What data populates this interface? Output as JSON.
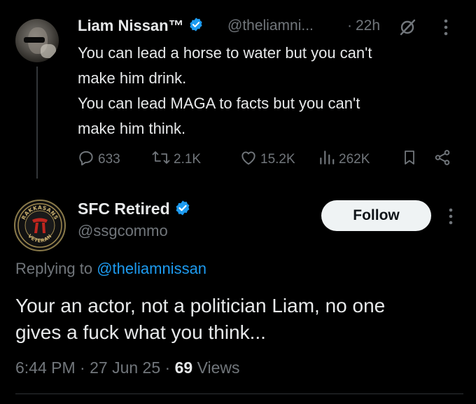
{
  "parent_tweet": {
    "author_name": "Liam Nissan™",
    "handle": "@theliamni...",
    "separator": "·",
    "time": "22h",
    "text_lines": [
      "You can lead a horse to water but you can't",
      "make him drink.",
      "You can lead MAGA to facts but you can't",
      "make him think."
    ],
    "stats": {
      "replies": "633",
      "reposts": "2.1K",
      "likes": "15.2K",
      "views": "262K"
    }
  },
  "reply_tweet": {
    "author_name": "SFC Retired",
    "handle": "@ssgcommo",
    "follow_label": "Follow",
    "replying_prefix": "Replying to ",
    "replying_to": "@theliamnissan",
    "text_lines": [
      "Your an actor, not a politician Liam, no one",
      "gives a fuck what you think..."
    ],
    "time": "6:44 PM",
    "separator": "·",
    "date": "27 Jun 25",
    "views_count": "69",
    "views_label": "Views",
    "avatar_text_top": "RAKKASANS",
    "avatar_text_bottom": "VETERAN"
  },
  "colors": {
    "background": "#000000",
    "text": "#e7e9ea",
    "muted": "#71767b",
    "link": "#1d9bf0",
    "verified": "#1d9bf0",
    "follow_bg": "#eff3f4"
  },
  "icons": [
    "verified-badge-icon",
    "grok-icon",
    "more-icon",
    "reply-icon",
    "repost-icon",
    "like-icon",
    "views-icon",
    "bookmark-icon",
    "share-icon"
  ]
}
